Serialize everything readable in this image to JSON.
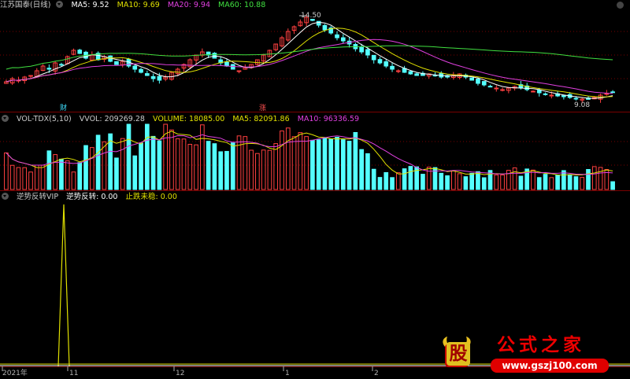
{
  "main_pane": {
    "title": "江苏国泰(日线)",
    "indicators": [
      {
        "label": "MA5: 9.52",
        "color": "#ffffff"
      },
      {
        "label": "MA10: 9.69",
        "color": "#e0e000"
      },
      {
        "label": "MA20: 9.94",
        "color": "#e040e0"
      },
      {
        "label": "MA60: 10.88",
        "color": "#40e040"
      }
    ],
    "high_label": "14.50",
    "low_label": "9.08",
    "marker_cai": "财",
    "marker_zhang": "涨"
  },
  "volume_pane": {
    "title": "VOL-TDX(5,10)",
    "indicators": [
      {
        "label": "VVOL: 209269.28",
        "color": "#cccccc"
      },
      {
        "label": "VOLUME: 18085.00",
        "color": "#e0e000"
      },
      {
        "label": "MA5: 82091.86",
        "color": "#e0e000"
      },
      {
        "label": "MA10: 96336.59",
        "color": "#e040e0"
      }
    ]
  },
  "signal_pane": {
    "title": "逆势反转VIP",
    "indicators": [
      {
        "label": "逆势反转: 0.00",
        "color": "#ffffff"
      },
      {
        "label": "止跌未稳: 0.00",
        "color": "#e0e000"
      }
    ]
  },
  "x_axis": {
    "labels": [
      "2021年",
      "11",
      "12",
      "1",
      "2"
    ]
  },
  "watermark": {
    "glyph": "股",
    "name": "公式之家",
    "url": "www.gszj100.com"
  },
  "colors": {
    "up": "#ff4040",
    "down": "#54ffff",
    "grid": "#7a0000",
    "ma5": "#ffffff",
    "ma10": "#e0e000",
    "ma20": "#e040e0",
    "ma60": "#40e040"
  },
  "chart_data": {
    "type": "candlestick",
    "series_close": [
      10.2,
      10.4,
      10.3,
      10.5,
      10.6,
      10.9,
      11.2,
      11.0,
      11.4,
      11.3,
      11.8,
      12.2,
      12.0,
      11.7,
      11.9,
      11.6,
      11.8,
      11.5,
      11.3,
      11.5,
      11.2,
      11.0,
      10.8,
      10.6,
      10.4,
      10.3,
      10.5,
      10.8,
      11.0,
      11.3,
      11.6,
      11.9,
      12.1,
      11.9,
      11.7,
      11.4,
      11.2,
      11.0,
      10.9,
      11.1,
      11.3,
      11.6,
      11.9,
      12.2,
      12.6,
      13.0,
      13.4,
      13.7,
      14.0,
      14.3,
      14.1,
      13.8,
      13.5,
      13.3,
      13.0,
      12.8,
      12.6,
      12.3,
      12.1,
      11.9,
      11.6,
      11.4,
      11.2,
      11.0,
      10.9,
      10.8,
      10.7,
      10.6,
      10.6,
      10.7,
      10.6,
      10.5,
      10.5,
      10.6,
      10.7,
      10.5,
      10.3,
      10.1,
      10.0,
      9.9,
      9.8,
      9.7,
      9.8,
      9.9,
      9.8,
      9.7,
      9.6,
      9.5,
      9.4,
      9.35,
      9.3,
      9.25,
      9.2,
      9.15,
      9.1,
      9.08,
      9.2,
      9.35,
      9.45,
      9.52
    ]
  }
}
